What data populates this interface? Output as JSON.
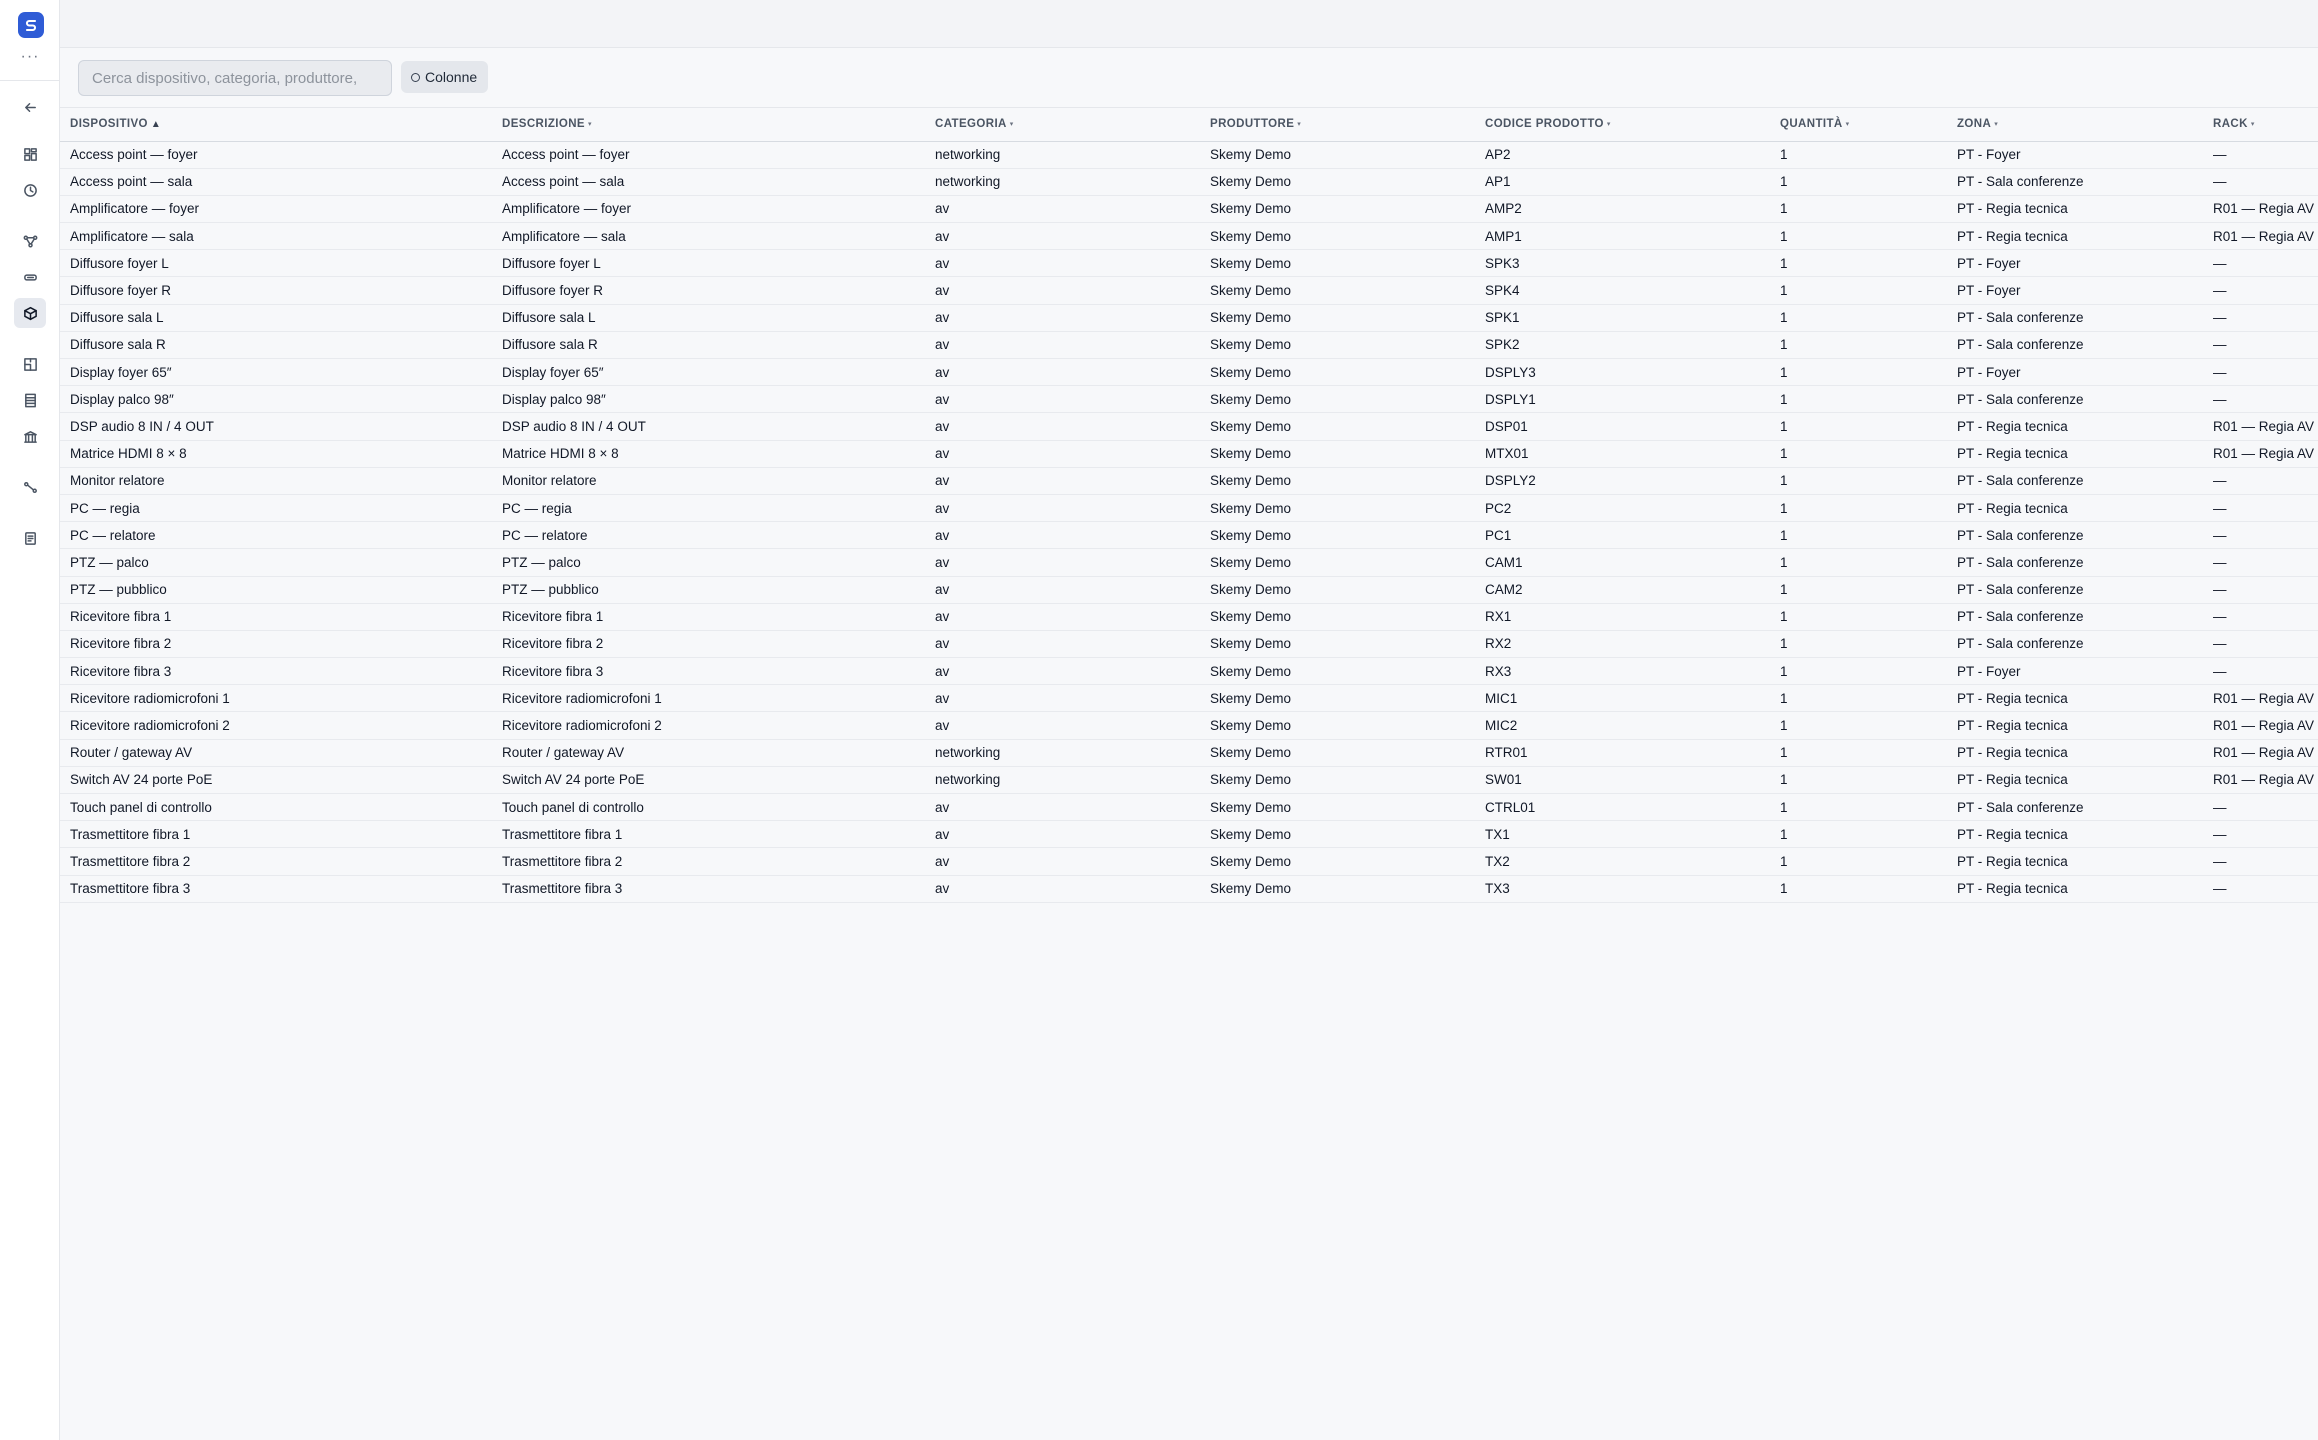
{
  "sidebar": {
    "more_label": "···",
    "nav": [
      {
        "icon": "back-arrow-icon"
      },
      {
        "icon": "dashboard-icon"
      },
      {
        "icon": "history-icon"
      },
      {
        "icon": "topology-icon"
      },
      {
        "icon": "connector-icon"
      },
      {
        "icon": "devices-box-icon",
        "active": true
      },
      {
        "icon": "floor-plan-icon"
      },
      {
        "icon": "rack-icon"
      },
      {
        "icon": "building-icon"
      },
      {
        "icon": "cable-icon"
      },
      {
        "icon": "document-icon"
      }
    ]
  },
  "toolbar": {
    "search_placeholder": "Cerca dispositivo, categoria, produttore,",
    "columns_label": "Colonne"
  },
  "table": {
    "columns": [
      {
        "label": "DISPOSITIVO",
        "sort": "▲"
      },
      {
        "label": "DESCRIZIONE",
        "sort": "▾"
      },
      {
        "label": "CATEGORIA",
        "sort": "▾"
      },
      {
        "label": "PRODUTTORE",
        "sort": "▾"
      },
      {
        "label": "CODICE PRODOTTO",
        "sort": "▾"
      },
      {
        "label": "QUANTITÀ",
        "sort": "▾"
      },
      {
        "label": "ZONA",
        "sort": "▾"
      },
      {
        "label": "RACK",
        "sort": "▾"
      }
    ],
    "rows": [
      [
        "Access point — foyer",
        "Access point — foyer",
        "networking",
        "Skemy Demo",
        "AP2",
        "1",
        "PT - Foyer",
        "—"
      ],
      [
        "Access point — sala",
        "Access point — sala",
        "networking",
        "Skemy Demo",
        "AP1",
        "1",
        "PT - Sala conferenze",
        "—"
      ],
      [
        "Amplificatore — foyer",
        "Amplificatore — foyer",
        "av",
        "Skemy Demo",
        "AMP2",
        "1",
        "PT - Regia tecnica",
        "R01 — Regia AV"
      ],
      [
        "Amplificatore — sala",
        "Amplificatore — sala",
        "av",
        "Skemy Demo",
        "AMP1",
        "1",
        "PT - Regia tecnica",
        "R01 — Regia AV"
      ],
      [
        "Diffusore foyer L",
        "Diffusore foyer L",
        "av",
        "Skemy Demo",
        "SPK3",
        "1",
        "PT - Foyer",
        "—"
      ],
      [
        "Diffusore foyer R",
        "Diffusore foyer R",
        "av",
        "Skemy Demo",
        "SPK4",
        "1",
        "PT - Foyer",
        "—"
      ],
      [
        "Diffusore sala L",
        "Diffusore sala L",
        "av",
        "Skemy Demo",
        "SPK1",
        "1",
        "PT - Sala conferenze",
        "—"
      ],
      [
        "Diffusore sala R",
        "Diffusore sala R",
        "av",
        "Skemy Demo",
        "SPK2",
        "1",
        "PT - Sala conferenze",
        "—"
      ],
      [
        "Display foyer 65″",
        "Display foyer 65″",
        "av",
        "Skemy Demo",
        "DSPLY3",
        "1",
        "PT - Foyer",
        "—"
      ],
      [
        "Display palco 98″",
        "Display palco 98″",
        "av",
        "Skemy Demo",
        "DSPLY1",
        "1",
        "PT - Sala conferenze",
        "—"
      ],
      [
        "DSP audio 8 IN / 4 OUT",
        "DSP audio 8 IN / 4 OUT",
        "av",
        "Skemy Demo",
        "DSP01",
        "1",
        "PT - Regia tecnica",
        "R01 — Regia AV"
      ],
      [
        "Matrice HDMI 8 × 8",
        "Matrice HDMI 8 × 8",
        "av",
        "Skemy Demo",
        "MTX01",
        "1",
        "PT - Regia tecnica",
        "R01 — Regia AV"
      ],
      [
        "Monitor relatore",
        "Monitor relatore",
        "av",
        "Skemy Demo",
        "DSPLY2",
        "1",
        "PT - Sala conferenze",
        "—"
      ],
      [
        "PC — regia",
        "PC — regia",
        "av",
        "Skemy Demo",
        "PC2",
        "1",
        "PT - Regia tecnica",
        "—"
      ],
      [
        "PC — relatore",
        "PC — relatore",
        "av",
        "Skemy Demo",
        "PC1",
        "1",
        "PT - Sala conferenze",
        "—"
      ],
      [
        "PTZ — palco",
        "PTZ — palco",
        "av",
        "Skemy Demo",
        "CAM1",
        "1",
        "PT - Sala conferenze",
        "—"
      ],
      [
        "PTZ — pubblico",
        "PTZ — pubblico",
        "av",
        "Skemy Demo",
        "CAM2",
        "1",
        "PT - Sala conferenze",
        "—"
      ],
      [
        "Ricevitore fibra 1",
        "Ricevitore fibra 1",
        "av",
        "Skemy Demo",
        "RX1",
        "1",
        "PT - Sala conferenze",
        "—"
      ],
      [
        "Ricevitore fibra 2",
        "Ricevitore fibra 2",
        "av",
        "Skemy Demo",
        "RX2",
        "1",
        "PT - Sala conferenze",
        "—"
      ],
      [
        "Ricevitore fibra 3",
        "Ricevitore fibra 3",
        "av",
        "Skemy Demo",
        "RX3",
        "1",
        "PT - Foyer",
        "—"
      ],
      [
        "Ricevitore radiomicrofoni 1",
        "Ricevitore radiomicrofoni 1",
        "av",
        "Skemy Demo",
        "MIC1",
        "1",
        "PT - Regia tecnica",
        "R01 — Regia AV"
      ],
      [
        "Ricevitore radiomicrofoni 2",
        "Ricevitore radiomicrofoni 2",
        "av",
        "Skemy Demo",
        "MIC2",
        "1",
        "PT - Regia tecnica",
        "R01 — Regia AV"
      ],
      [
        "Router / gateway AV",
        "Router / gateway AV",
        "networking",
        "Skemy Demo",
        "RTR01",
        "1",
        "PT - Regia tecnica",
        "R01 — Regia AV"
      ],
      [
        "Switch AV 24 porte PoE",
        "Switch AV 24 porte PoE",
        "networking",
        "Skemy Demo",
        "SW01",
        "1",
        "PT - Regia tecnica",
        "R01 — Regia AV"
      ],
      [
        "Touch panel di controllo",
        "Touch panel di controllo",
        "av",
        "Skemy Demo",
        "CTRL01",
        "1",
        "PT - Sala conferenze",
        "—"
      ],
      [
        "Trasmettitore fibra 1",
        "Trasmettitore fibra 1",
        "av",
        "Skemy Demo",
        "TX1",
        "1",
        "PT - Regia tecnica",
        "—"
      ],
      [
        "Trasmettitore fibra 2",
        "Trasmettitore fibra 2",
        "av",
        "Skemy Demo",
        "TX2",
        "1",
        "PT - Regia tecnica",
        "—"
      ],
      [
        "Trasmettitore fibra 3",
        "Trasmettitore fibra 3",
        "av",
        "Skemy Demo",
        "TX3",
        "1",
        "PT - Regia tecnica",
        "—"
      ]
    ]
  },
  "colors": {
    "accent": "#2f5cd6",
    "page_background": "#f7f8fa",
    "sidebar_background": "#ffffff",
    "border": "#e5e7eb"
  }
}
